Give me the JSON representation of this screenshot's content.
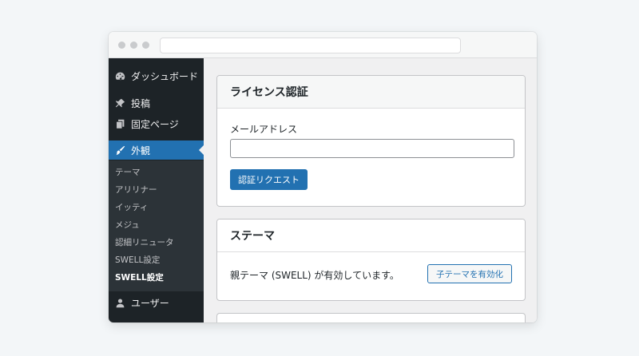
{
  "sidebar": {
    "items": [
      {
        "label": "ダッシュボード",
        "icon": "dashboard-icon"
      },
      {
        "label": "投稿",
        "icon": "pin-icon"
      },
      {
        "label": "固定ページ",
        "icon": "pages-icon"
      },
      {
        "label": "外観",
        "icon": "appearance-icon",
        "active": true
      },
      {
        "label": "ユーザー",
        "icon": "user-icon"
      }
    ],
    "submenu": [
      "テーマ",
      "アリリナー",
      "イッティ",
      "メジュ",
      "認細リニュータ",
      "SWELL設定",
      "SWELL設定"
    ],
    "submenu_current_index": 6
  },
  "license_card": {
    "title": "ライセンス認証",
    "email_label": "メールアドレス",
    "email_value": "",
    "request_button": "認証リクエスト"
  },
  "theme_card": {
    "title": "ステーマ",
    "status_text": "親テーマ (SWELL) が有効しています。",
    "child_button": "子テーマを有効化"
  },
  "colors": {
    "sidebar_bg": "#1d2327",
    "submenu_bg": "#2c3338",
    "accent": "#2271b1",
    "content_bg": "#f0f0f1"
  }
}
